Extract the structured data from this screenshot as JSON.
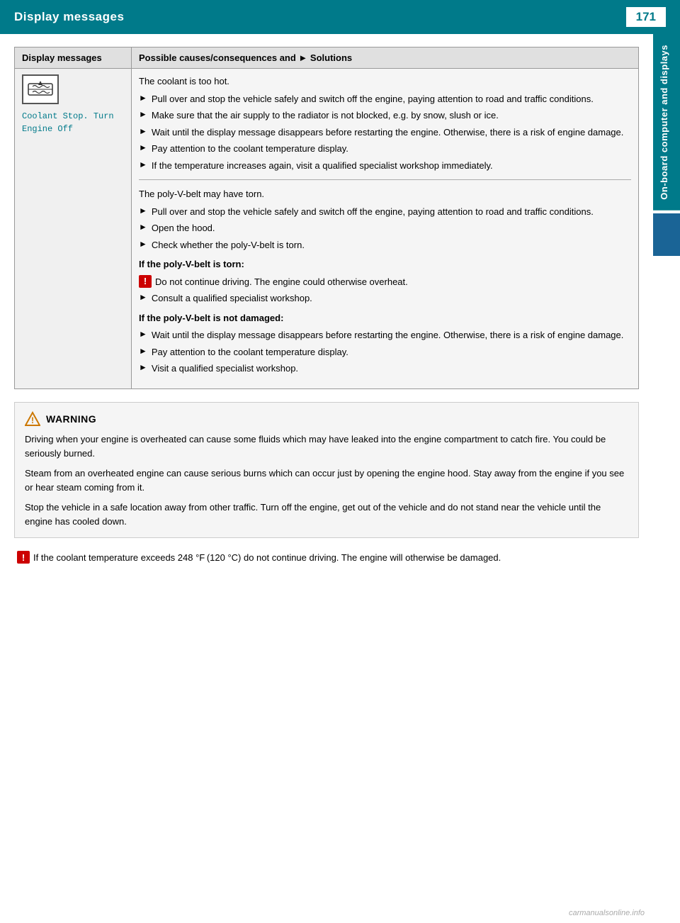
{
  "header": {
    "title": "Display messages",
    "page_number": "171"
  },
  "sidebar": {
    "label": "On-board computer and displays"
  },
  "table": {
    "col1_header": "Display messages",
    "col2_header": "Possible causes/consequences and ► Solutions",
    "row": {
      "display_msg_text": "Coolant Stop. Turn\nEngine Off",
      "sections": [
        {
          "intro": "The coolant is too hot.",
          "bullets": [
            "Pull over and stop the vehicle safely and switch off the engine, paying attention to road and traffic conditions.",
            "Make sure that the air supply to the radiator is not blocked, e.g. by snow, slush or ice.",
            "Wait until the display message disappears before restarting the engine. Otherwise, there is a risk of engine damage.",
            "Pay attention to the coolant temperature display.",
            "If the temperature increases again, visit a qualified specialist workshop immediately."
          ]
        },
        {
          "intro": "The poly-V-belt may have torn.",
          "bullets": [
            "Pull over and stop the vehicle safely and switch off the engine, paying attention to road and traffic conditions.",
            "Open the hood.",
            "Check whether the poly-V-belt is torn."
          ],
          "bold_section_1": {
            "label": "If the poly-V-belt is torn:",
            "hazard_note": "Do not continue driving. The engine could otherwise overheat.",
            "extra_bullet": "Consult a qualified specialist workshop."
          },
          "bold_section_2": {
            "label": "If the poly-V-belt is not damaged:",
            "bullets": [
              "Wait until the display message disappears before restarting the engine. Otherwise, there is a risk of engine damage.",
              "Pay attention to the coolant temperature display.",
              "Visit a qualified specialist workshop."
            ]
          }
        }
      ]
    }
  },
  "warning_box": {
    "title": "WARNING",
    "paragraphs": [
      "Driving when your engine is overheated can cause some fluids which may have leaked into the engine compartment to catch fire. You could be seriously burned.",
      "Steam from an overheated engine can cause serious burns which can occur just by opening the engine hood. Stay away from the engine if you see or hear steam coming from it.",
      "Stop the vehicle in a safe location away from other traffic. Turn off the engine, get out of the vehicle and do not stand near the vehicle until the engine has cooled down."
    ]
  },
  "hazard_note": {
    "text": "If the coolant temperature exceeds 248 °F (120 °C) do not continue driving. The engine will otherwise be damaged."
  },
  "watermark": "carmanualsonline.info"
}
